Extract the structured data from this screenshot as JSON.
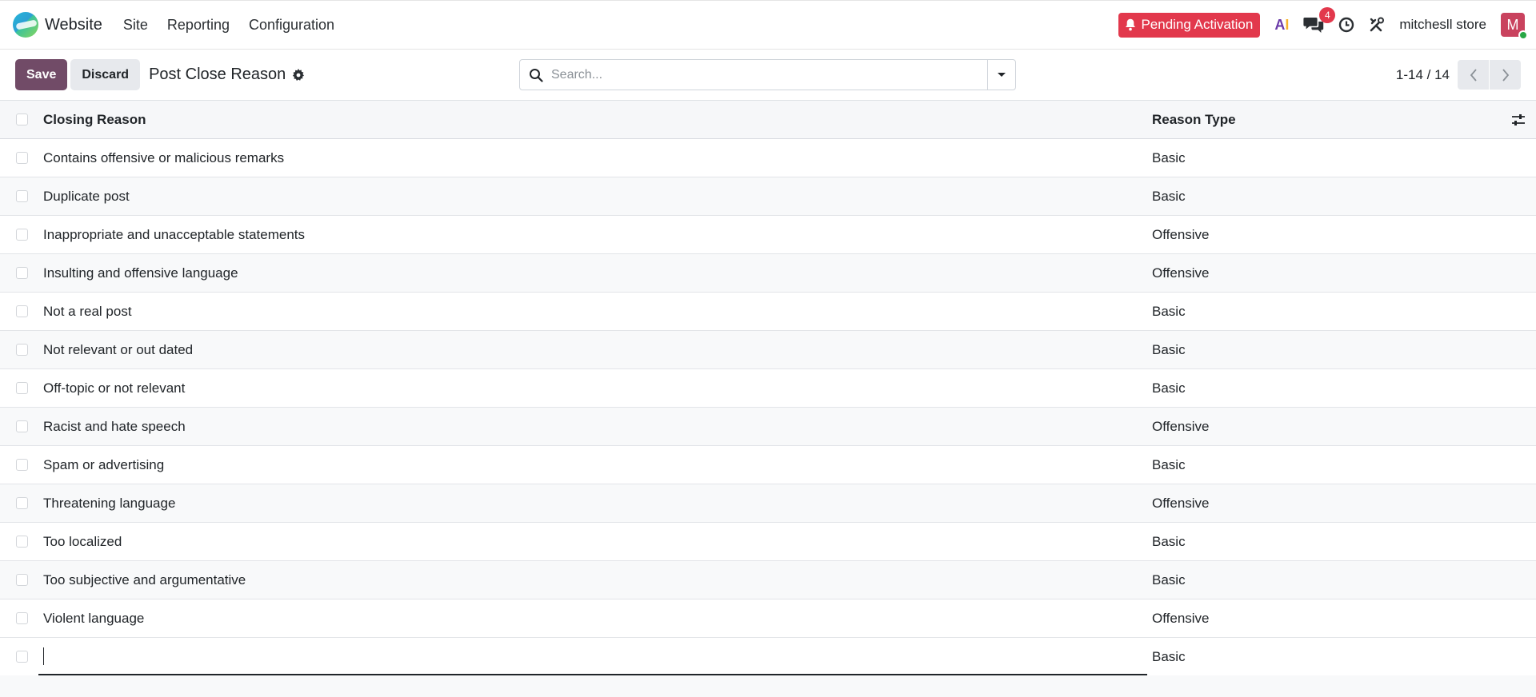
{
  "navbar": {
    "app_name": "Website",
    "menu": [
      "Site",
      "Reporting",
      "Configuration"
    ],
    "pending_label": "Pending Activation",
    "ai_label": "AI",
    "chat_badge": "4",
    "store_name": "mitchesll store",
    "avatar_letter": "M",
    "icons": [
      "website-logo-icon",
      "bell-icon",
      "ai-icon",
      "chat-icon",
      "clock-icon",
      "tools-icon"
    ]
  },
  "control": {
    "save_label": "Save",
    "discard_label": "Discard",
    "title": "Post Close Reason",
    "search_placeholder": "Search...",
    "pager_value": "1-14 / 14"
  },
  "table": {
    "headers": {
      "reason": "Closing Reason",
      "type": "Reason Type"
    },
    "rows": [
      {
        "reason": "Contains offensive or malicious remarks",
        "type": "Basic"
      },
      {
        "reason": "Duplicate post",
        "type": "Basic"
      },
      {
        "reason": "Inappropriate and unacceptable statements",
        "type": "Offensive"
      },
      {
        "reason": "Insulting and offensive language",
        "type": "Offensive"
      },
      {
        "reason": "Not a real post",
        "type": "Basic"
      },
      {
        "reason": "Not relevant or out dated",
        "type": "Basic"
      },
      {
        "reason": "Off-topic or not relevant",
        "type": "Basic"
      },
      {
        "reason": "Racist and hate speech",
        "type": "Offensive"
      },
      {
        "reason": "Spam or advertising",
        "type": "Basic"
      },
      {
        "reason": "Threatening language",
        "type": "Offensive"
      },
      {
        "reason": "Too localized",
        "type": "Basic"
      },
      {
        "reason": "Too subjective and argumentative",
        "type": "Basic"
      },
      {
        "reason": "Violent language",
        "type": "Offensive"
      }
    ],
    "new_row": {
      "reason": "",
      "type": "Basic"
    }
  },
  "colors": {
    "primary": "#714b67",
    "danger": "#e2384c",
    "online": "#28a745"
  }
}
